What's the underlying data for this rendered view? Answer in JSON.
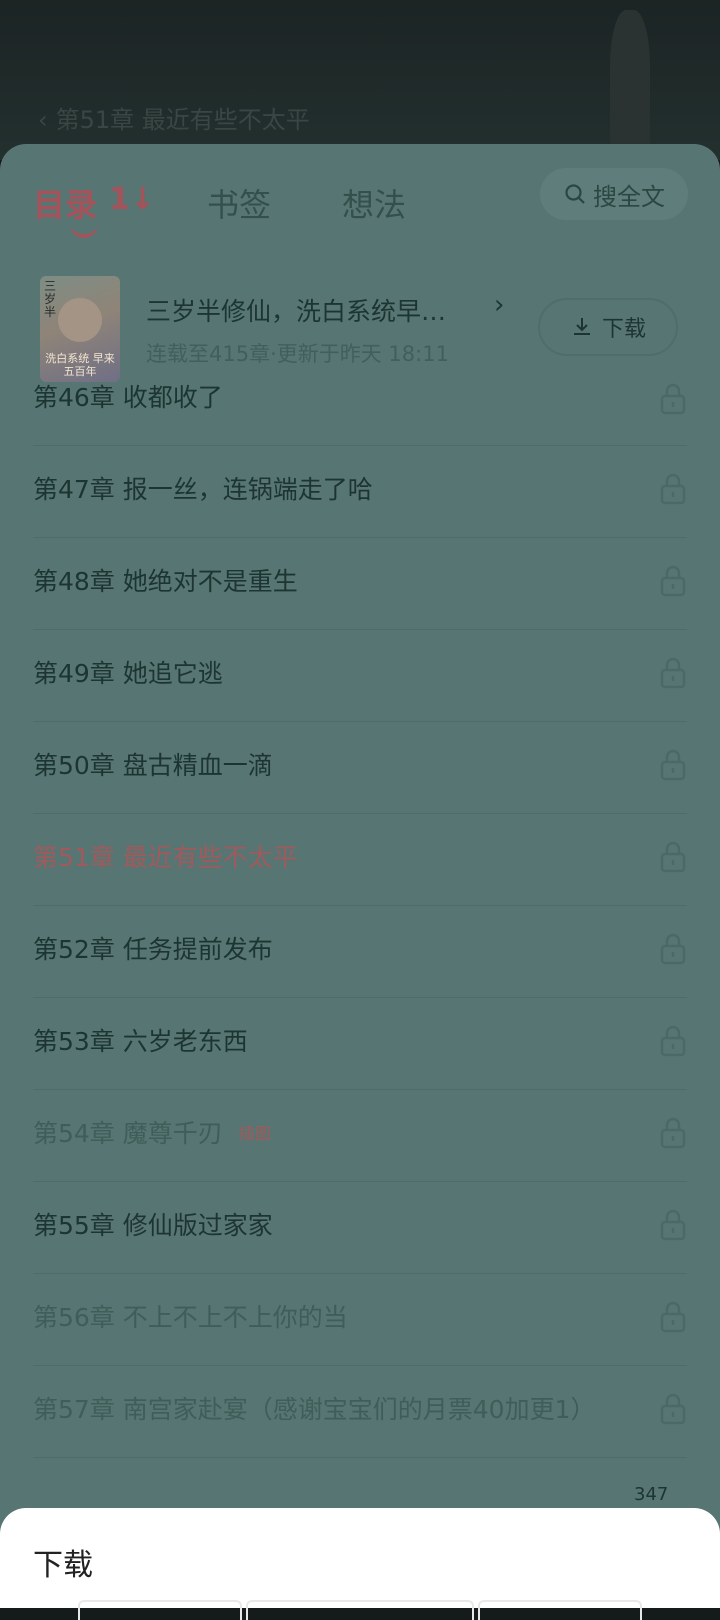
{
  "background": {
    "chapter_title": "第51章 最近有些不太平",
    "back_icon": "chevron-left-icon"
  },
  "tabs": {
    "catalog": "目录",
    "bookmarks": "书签",
    "thoughts": "想法",
    "sort_icon": "sort-icon",
    "search": "搜全文"
  },
  "book": {
    "title": "三岁半修仙，洗白系统早…",
    "meta": "连载至415章·更新于昨天 18:11",
    "download": "下载",
    "cover_text_top": "三岁半",
    "cover_text_bottom": "洗白系统 早来五百年"
  },
  "chapters": [
    {
      "title": "第46章 收都收了",
      "state": "normal"
    },
    {
      "title": "第47章 报一丝，连锅端走了哈",
      "state": "normal"
    },
    {
      "title": "第48章 她绝对不是重生",
      "state": "normal"
    },
    {
      "title": "第49章 她追它逃",
      "state": "normal"
    },
    {
      "title": "第50章 盘古精血一滴",
      "state": "normal"
    },
    {
      "title": "第51章 最近有些不太平",
      "state": "current"
    },
    {
      "title": "第52章 任务提前发布",
      "state": "normal"
    },
    {
      "title": "第53章 六岁老东西",
      "state": "normal"
    },
    {
      "title": "第54章 魔尊千刃",
      "state": "read",
      "badge": "插图"
    },
    {
      "title": "第55章 修仙版过家家",
      "state": "normal"
    },
    {
      "title": "第56章 不上不上不上你的当",
      "state": "read"
    },
    {
      "title": "第57章 南宫家赴宴（感谢宝宝们的月票40加更1）",
      "state": "read"
    }
  ],
  "bottom_bar": {
    "comment_count": "347"
  },
  "sheet": {
    "title": "下载"
  },
  "colors": {
    "accent": "#a5525a",
    "panel": "#577572",
    "text": "#1d3532"
  }
}
